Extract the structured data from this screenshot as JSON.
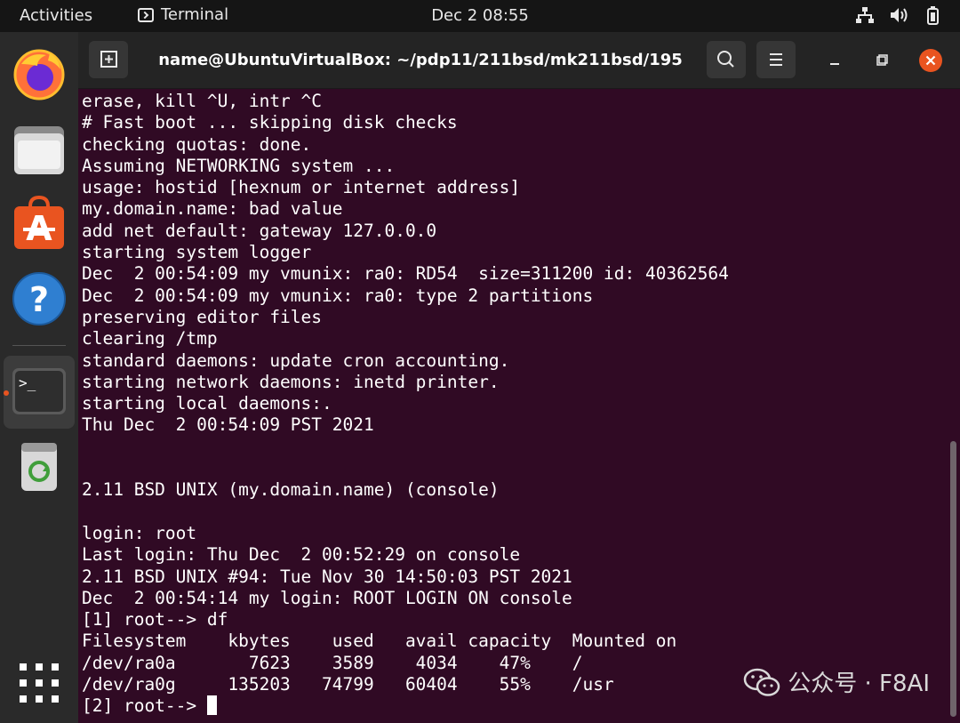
{
  "topbar": {
    "activities": "Activities",
    "app_name": "Terminal",
    "clock": "Dec 2  08:55"
  },
  "dock": {
    "items": [
      "firefox-icon",
      "files-icon",
      "software-store-icon",
      "help-icon",
      "terminal-icon",
      "trash-icon",
      "app-grid-icon"
    ]
  },
  "window": {
    "title": "name@UbuntuVirtualBox: ~/pdp11/211bsd/mk211bsd/195",
    "close_color": "#e95420"
  },
  "terminal": {
    "lines": [
      "erase, kill ^U, intr ^C",
      "# Fast boot ... skipping disk checks",
      "checking quotas: done.",
      "Assuming NETWORKING system ...",
      "usage: hostid [hexnum or internet address]",
      "my.domain.name: bad value",
      "add net default: gateway 127.0.0.0",
      "starting system logger",
      "Dec  2 00:54:09 my vmunix: ra0: RD54  size=311200 id: 40362564",
      "Dec  2 00:54:09 my vmunix: ra0: type 2 partitions",
      "preserving editor files",
      "clearing /tmp",
      "standard daemons: update cron accounting.",
      "starting network daemons: inetd printer.",
      "starting local daemons:.",
      "Thu Dec  2 00:54:09 PST 2021",
      "",
      "",
      "2.11 BSD UNIX (my.domain.name) (console)",
      "",
      "login: root",
      "Last login: Thu Dec  2 00:52:29 on console",
      "2.11 BSD UNIX #94: Tue Nov 30 14:50:03 PST 2021",
      "Dec  2 00:54:14 my login: ROOT LOGIN ON console",
      "[1] root--> df",
      "Filesystem    kbytes    used   avail capacity  Mounted on",
      "/dev/ra0a       7623    3589    4034    47%    /",
      "/dev/ra0g     135203   74799   60404    55%    /usr"
    ],
    "prompt": "[2] root--> "
  },
  "watermark": {
    "text": "公众号 · F8AI"
  }
}
